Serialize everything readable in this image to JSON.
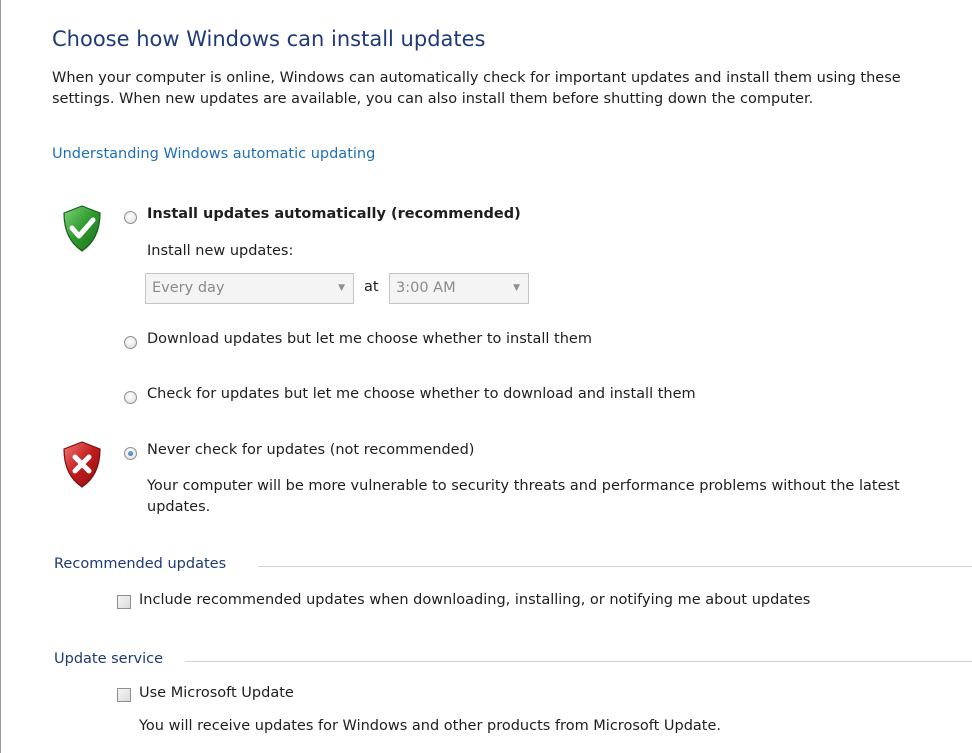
{
  "header": {
    "title": "Choose how Windows can install updates",
    "description": "When your computer is online, Windows can automatically check for important updates and install them using these settings. When new updates are available, you can also install them before shutting down the computer.",
    "help_link": "Understanding Windows automatic updating"
  },
  "options": {
    "auto": {
      "label": "Install updates automatically (recommended)",
      "checked": false,
      "sublabel": "Install new updates:",
      "day_select": "Every day",
      "at_label": "at",
      "time_select": "3:00 AM"
    },
    "download": {
      "label": "Download updates but let me choose whether to install them",
      "checked": false
    },
    "check": {
      "label": "Check for updates but let me choose whether to download and install them",
      "checked": false
    },
    "never": {
      "label": "Never check for updates (not recommended)",
      "checked": true,
      "warning": "Your computer will be more vulnerable to security threats and performance problems without the latest updates."
    }
  },
  "recommended": {
    "heading": "Recommended updates",
    "checkbox_label": "Include recommended updates when downloading, installing, or notifying me about updates",
    "checked": false
  },
  "update_service": {
    "heading": "Update service",
    "checkbox_label": "Use Microsoft Update",
    "checked": false,
    "note": "You will receive updates for Windows and other products from Microsoft Update."
  },
  "icons": {
    "green_shield": "shield-check-icon",
    "red_shield": "shield-x-icon",
    "dropdown_arrow": "chevron-down-icon"
  },
  "colors": {
    "title": "#1e3a78",
    "link": "#1f6fb4",
    "shield_green": "#2e9a2e",
    "shield_red": "#c21c1c"
  }
}
